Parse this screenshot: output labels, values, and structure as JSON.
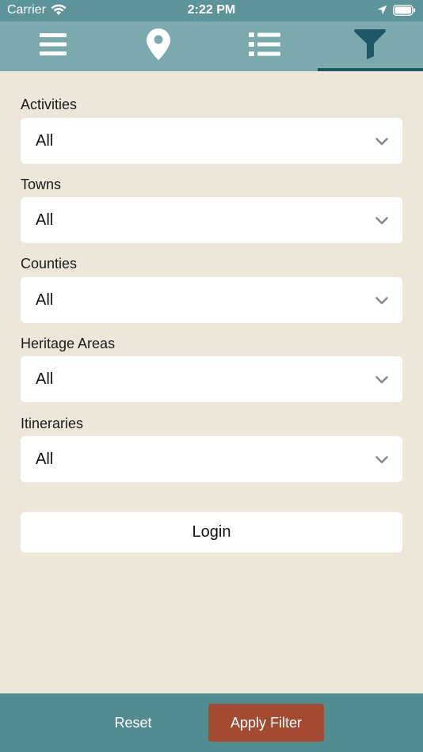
{
  "status_bar": {
    "carrier": "Carrier",
    "time": "2:22 PM"
  },
  "tabs": [
    {
      "icon": "menu-icon",
      "active": false
    },
    {
      "icon": "map-pin-icon",
      "active": false
    },
    {
      "icon": "list-icon",
      "active": false
    },
    {
      "icon": "filter-icon",
      "active": true
    }
  ],
  "filters": [
    {
      "label": "Activities",
      "value": "All"
    },
    {
      "label": "Towns",
      "value": "All"
    },
    {
      "label": "Counties",
      "value": "All"
    },
    {
      "label": "Heritage Areas",
      "value": "All"
    },
    {
      "label": "Itineraries",
      "value": "All"
    }
  ],
  "login_label": "Login",
  "bottom_bar": {
    "reset_label": "Reset",
    "apply_label": "Apply Filter"
  },
  "colors": {
    "status_bar": "#5c9499",
    "tab_bar": "#7aa9ae",
    "active_indicator": "#1e5864",
    "background": "#ece7d9",
    "bottom_bar": "#528b90",
    "apply_button": "#a34a33"
  }
}
